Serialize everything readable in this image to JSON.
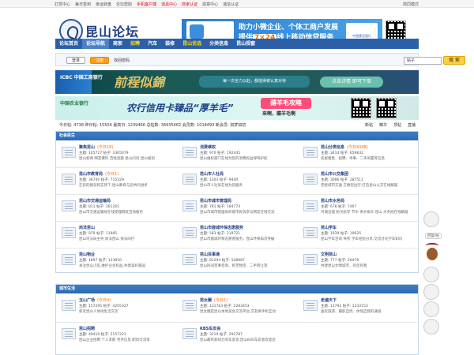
{
  "topbar": {
    "links": [
      "打赏中心",
      "每日签到",
      "幸运转盘",
      "论坛帮助",
      "手机客户端",
      "道具中心",
      "商家认证",
      "勋章中心",
      "诚信认证"
    ],
    "hot_links": [
      4,
      5,
      6
    ],
    "right": "简同模式"
  },
  "header": {
    "logo_text": "昆山论坛",
    "banner_line1": "助力小微企业、个体工商户发展",
    "banner_line2_pre": "提供",
    "banner_line2_bold": "7×24",
    "banner_line2_post": "线上移动信贷服务",
    "banner_bank": "中国建设银行"
  },
  "nav": {
    "items": [
      {
        "label": "论坛首页",
        "active": false,
        "hl": false
      },
      {
        "label": "论坛导航",
        "active": true,
        "hl": false
      },
      {
        "label": "商家",
        "active": false,
        "hl": false
      },
      {
        "label": "招聘",
        "active": false,
        "hl": true
      },
      {
        "label": "汽车",
        "active": false,
        "hl": false
      },
      {
        "label": "装修",
        "active": false,
        "hl": false
      },
      {
        "label": "昆山优选",
        "active": false,
        "hl": true
      },
      {
        "label": "分类信息",
        "active": false,
        "hl": false
      },
      {
        "label": "昆山视窗",
        "active": false,
        "hl": false
      }
    ]
  },
  "login": {
    "login_label": "登录",
    "register_label": "注册",
    "forgot_label": "找回密码",
    "search_scope": "帖子",
    "search_label": "搜 索"
  },
  "ads": {
    "ad1_bank": "ICBC 中国工商银行",
    "ad1_calligraphy": "前程似錦",
    "ad1_mid": "每一次全力以赴，都值得被认真对待",
    "ad1_btn": "点击详情 即可下单",
    "ad2_bank": "中国农业银行",
    "ad2_slogan": "农行信用卡臻品“厚羊毛”",
    "ad2_tag": "薅羊毛攻略",
    "ad2_sub": "来啊，薅羊毛啊"
  },
  "stats": {
    "text": "今日帖: 4738 昨日帖: 15504 最高日: 1239466 总帖数: 36935462 会员数: 1018493 新会员: 如梦如初",
    "tabs": [
      "新帖",
      "精华",
      "顶帖",
      "直播"
    ]
  },
  "sections": [
    {
      "title": "社会民生",
      "forums": [
        {
          "name": "聚焦昆山",
          "today": "(今日18)",
          "stat": "主题: 105727  帖子: 3365079",
          "desc": "昆山新闻 网友爆料 百姓话题 昆山问问 昆山规划"
        },
        {
          "name": "消费维权",
          "today": "",
          "stat": "主题: 970  帖子: 192445",
          "desc": "昆山维权部门在线为您的消费权益保驾护航"
        },
        {
          "name": "昆山分类信息",
          "today": "(今日4398)",
          "stat": "主题: 3414  帖子: 659832",
          "desc": "房屋租售、招聘、寻事、二手闲置等信息"
        },
        {
          "name": "昆山市教育局",
          "today": "(今日1)",
          "stat": "主题: 36740  帖子: 715329",
          "desc": "在您的建议和支持下,昆山教育与您共同进步"
        },
        {
          "name": "昆山市人社局",
          "today": "",
          "stat": "主题: 1303  帖子: 9440",
          "desc": "昆山市人社局在线为您服务"
        },
        {
          "name": "昆山市公交集团",
          "today": "",
          "stat": "主题: 3086  帖子: 287511",
          "desc": "完善城市交通 方便您出行,打造昆山公交在线解疑"
        },
        {
          "name": "昆山市交通运输局",
          "today": "",
          "stat": "主题: 811  帖子: 261265",
          "desc": "昆山市交通运输局在线受理网友咨询服务"
        },
        {
          "name": "昆山市城市管理局",
          "today": "",
          "stat": "主题: 781  帖子: 184774",
          "desc": "昆山市城市管理局听取市民诉求与网友在线交流"
        },
        {
          "name": "昆山市水务局",
          "today": "",
          "stat": "主题: 678  帖子: 7467",
          "desc": "河湖治理 防汛抗旱 节水 供水排水 昆山 水务局在线解疑"
        },
        {
          "name": "尚法昆山",
          "today": "",
          "stat": "主题: 979  帖子: 11985",
          "desc": "昆山司法局主导 尚法昆山 依法同行"
        },
        {
          "name": "昆山市鹿城环保志愿服务",
          "today": "",
          "stat": "主题: 583  帖子: 219721",
          "desc": "昆山市鹿城环保志愿者服务，昆山环保再次突破"
        },
        {
          "name": "昆山学车",
          "today": "",
          "stat": "主题: 1939  帖子: 19625",
          "desc": "昆山学车咨询 驾考 学车经验分享,交流讨论学车知识"
        },
        {
          "name": "昆山物业",
          "today": "",
          "stat": "主题: 1897  帖子: 133850",
          "desc": "关注昆山小区,维护业主权益,共建美好家园"
        },
        {
          "name": "昆山百事通",
          "today": "",
          "stat": "主题: 81294  帖子: 548987",
          "desc": "昆山民间百事咨询、民苦物咨、二手转让等"
        },
        {
          "name": "文明昆山",
          "today": "",
          "stat": "主题: 777  帖子: 26479",
          "desc": "共建昆山文明城市，有您有我"
        }
      ]
    },
    {
      "title": "城市生活",
      "forums": [
        {
          "name": "玉山广场",
          "today": "(今日4)",
          "stat": "主题: 157295  帖子: 4205327",
          "desc": "新老昆山人休闲生活交流"
        },
        {
          "name": "昆女圈",
          "today": "(今日1)",
          "stat": "主题: 131763  帖子: 2283453",
          "desc": "昆女圈是昆山本地美女交流平台,交友拼手机互动"
        },
        {
          "name": "走遍天下",
          "today": "",
          "stat": "主题: 13792  帖子: 1233153",
          "desc": "喜欢旅游、摄影自然、体现自我的通道"
        },
        {
          "name": "昆山招聘",
          "today": "",
          "stat": "主题: 49419  帖子: 2157223",
          "desc": "昆山企业招聘 个人求职 劳务信息 职场交流等"
        },
        {
          "name": "KBS车友会",
          "today": "",
          "stat": "主题: 3219  帖子: 292787",
          "desc": "昆山最有影响力的车友会,昆山KBS车友会欢迎您"
        }
      ]
    }
  ],
  "side": {
    "label": "回复/帖"
  }
}
